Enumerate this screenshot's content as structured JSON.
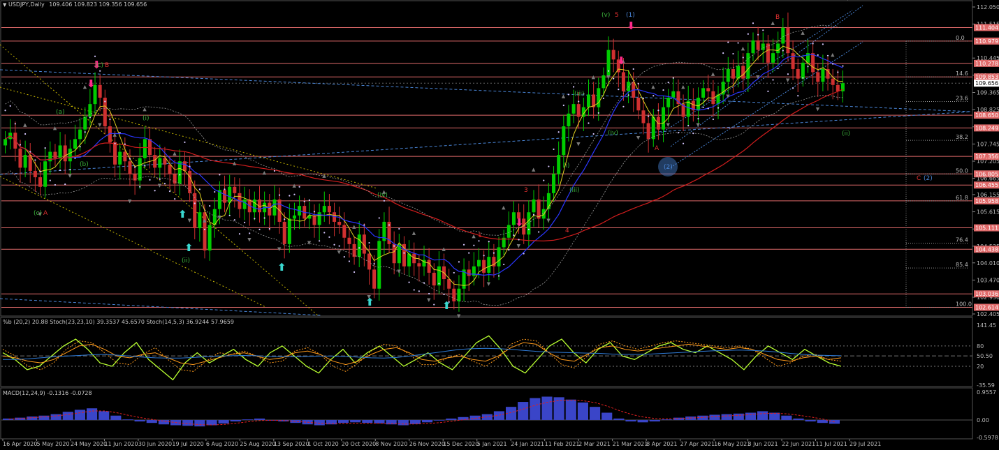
{
  "window": {
    "symbol_label": "USDJPY,Daily",
    "ohlc": "109.406 109.823 109.356 109.656",
    "icon": "triangle-down-icon"
  },
  "indicators": {
    "osc_label": "%b (20,2) 20.88  Stoch(23,23,10) 39.3537 45.6570  Stoch(14,5,3) 36.9244 57.9659",
    "macd_label": "MACD(12,24,9) -0.1316 -0.0728"
  },
  "colors": {
    "background": "#000000",
    "level_line": "#e06a6a",
    "candle_up": "#00cc00",
    "candle_down": "#d03030",
    "ma200": "#d11d1d",
    "ma_blue": "#2a36ff",
    "ma_yellow": "#e0d020",
    "wave_green": "#3ab03a",
    "wave_red": "#e03030",
    "wave_blue": "#4a86d8",
    "arrow_pink": "#ff2a8a",
    "arrow_cyan": "#3ad8d0",
    "sar_dots": "#d7c8ff",
    "fractal": "#7a7a7a"
  },
  "chart_data": [
    {
      "type": "candlestick",
      "title": "USDJPY,Daily",
      "ylim": [
        102.405,
        112.05
      ],
      "y_ticks": [
        "112.050",
        "111.515",
        "110.445",
        "109.905",
        "109.365",
        "108.825",
        "108.285",
        "107.745",
        "107.205",
        "106.665",
        "106.155",
        "105.615",
        "105.075",
        "104.535",
        "104.010",
        "103.470",
        "102.930",
        "102.405"
      ],
      "x_ticks": [
        "16 Apr 2020",
        "5 May 2020",
        "24 May 2020",
        "11 Jun 2020",
        "30 Jun 2020",
        "19 Jul 2020",
        "6 Aug 2020",
        "25 Aug 2020",
        "13 Sep 2020",
        "1 Oct 2020",
        "20 Oct 2020",
        "8 Nov 2020",
        "26 Nov 2020",
        "15 Dec 2020",
        "5 Jan 2021",
        "24 Jan 2021",
        "11 Feb 2021",
        "2 Mar 2021",
        "21 Mar 2021",
        "8 Apr 2021",
        "27 Apr 2021",
        "16 May 2021",
        "3 Jun 2021",
        "22 Jun 2021",
        "11 Jul 2021",
        "29 Jul 2021"
      ],
      "key_levels": [
        111.404,
        110.979,
        110.278,
        109.853,
        108.65,
        108.249,
        107.356,
        106.805,
        106.455,
        105.958,
        105.111,
        104.438,
        103.036,
        102.614
      ],
      "price_label": 109.656,
      "fib_levels": [
        {
          "label": "0.0",
          "value": 110.979
        },
        {
          "label": "14.6",
          "value": 109.853
        },
        {
          "label": "23.6",
          "value": 109.08
        },
        {
          "label": "38.2",
          "value": 107.86
        },
        {
          "label": "50.0",
          "value": 106.805
        },
        {
          "label": "61.8",
          "value": 105.96
        },
        {
          "label": "76.4",
          "value": 104.63
        },
        {
          "label": "85.4",
          "value": 103.85
        },
        {
          "label": "100.0",
          "value": 102.614
        }
      ],
      "closes": [
        107.9,
        108.1,
        107.6,
        107.0,
        107.4,
        106.9,
        106.7,
        106.4,
        107.2,
        107.5,
        107.3,
        107.7,
        107.2,
        107.6,
        107.9,
        108.2,
        108.6,
        109.0,
        109.6,
        109.2,
        108.3,
        107.8,
        107.1,
        107.5,
        107.2,
        106.8,
        106.6,
        107.3,
        107.9,
        107.4,
        107.0,
        107.3,
        107.1,
        106.8,
        106.5,
        107.2,
        106.9,
        106.2,
        105.1,
        105.6,
        104.4,
        105.2,
        105.7,
        106.3,
        105.9,
        106.4,
        106.2,
        105.7,
        106.0,
        105.6,
        106.0,
        105.6,
        105.9,
        105.5,
        106.0,
        105.3,
        104.6,
        105.4,
        105.5,
        105.8,
        105.4,
        105.5,
        105.2,
        105.6,
        105.8,
        105.6,
        105.3,
        105.2,
        104.8,
        104.6,
        104.2,
        104.9,
        104.3,
        103.8,
        103.2,
        104.7,
        105.3,
        104.6,
        104.0,
        104.6,
        103.9,
        104.3,
        104.0,
        103.9,
        104.1,
        103.7,
        103.3,
        103.9,
        103.5,
        103.2,
        102.8,
        103.2,
        103.8,
        103.6,
        103.9,
        104.1,
        103.7,
        104.2,
        103.9,
        104.5,
        104.8,
        105.2,
        105.6,
        105.4,
        104.9,
        105.6,
        106.0,
        105.4,
        105.7,
        106.2,
        106.8,
        107.4,
        108.3,
        108.7,
        109.0,
        108.6,
        108.9,
        109.3,
        108.9,
        109.5,
        109.9,
        110.7,
        110.4,
        110.0,
        109.4,
        109.7,
        109.2,
        108.8,
        108.4,
        107.9,
        108.6,
        108.2,
        108.9,
        109.2,
        109.4,
        109.0,
        108.6,
        109.1,
        108.8,
        109.2,
        109.5,
        109.4,
        109.0,
        109.3,
        109.7,
        110.1,
        109.8,
        110.2,
        109.8,
        110.6,
        111.0,
        110.7,
        110.9,
        110.3,
        110.6,
        110.9,
        111.4,
        110.6,
        110.1,
        109.8,
        110.3,
        110.6,
        110.0,
        109.7,
        110.1,
        109.8,
        109.6,
        109.4,
        109.656
      ]
    },
    {
      "type": "line",
      "title": "%b (20,2) 20.88  Stoch(23,23,10) 39.3537 45.6570  Stoch(14,5,3) 36.9244 57.9659",
      "ylim": [
        -35.59,
        141.45
      ],
      "y_ticks": [
        "141.45",
        "80",
        "50.50",
        "20",
        "-35.59"
      ],
      "series": [
        {
          "name": "%b (20,2)",
          "values": [
            60,
            40,
            10,
            20,
            50,
            80,
            100,
            70,
            30,
            20,
            60,
            90,
            40,
            10,
            -20,
            30,
            60,
            30,
            50,
            70,
            40,
            20,
            60,
            80,
            50,
            20,
            0,
            40,
            70,
            30,
            60,
            80,
            50,
            20,
            40,
            60,
            30,
            10,
            50,
            90,
            110,
            70,
            20,
            0,
            40,
            80,
            100,
            60,
            30,
            70,
            90,
            50,
            40,
            60,
            80,
            90,
            70,
            60,
            80,
            60,
            40,
            10,
            50,
            80,
            60,
            40,
            70,
            50,
            30,
            20
          ]
        },
        {
          "name": "Stoch(23,23,10)",
          "values": [
            50,
            45,
            35,
            30,
            40,
            60,
            80,
            85,
            70,
            50,
            45,
            55,
            60,
            45,
            30,
            25,
            35,
            45,
            55,
            60,
            50,
            40,
            45,
            60,
            65,
            55,
            35,
            25,
            35,
            55,
            70,
            75,
            60,
            40,
            35,
            45,
            50,
            40,
            35,
            50,
            75,
            90,
            85,
            60,
            40,
            35,
            55,
            75,
            80,
            70,
            65,
            70,
            75,
            80,
            85,
            80,
            75,
            70,
            75,
            70,
            55,
            40,
            35,
            45,
            50,
            40,
            45
          ]
        },
        {
          "name": "Stoch(14,5,3)",
          "values": [
            70,
            50,
            20,
            10,
            30,
            70,
            95,
            90,
            60,
            30,
            25,
            55,
            75,
            40,
            10,
            5,
            35,
            60,
            55,
            65,
            50,
            30,
            35,
            65,
            75,
            55,
            20,
            5,
            30,
            65,
            85,
            80,
            55,
            25,
            25,
            45,
            55,
            35,
            20,
            45,
            85,
            100,
            95,
            60,
            25,
            15,
            50,
            85,
            95,
            80,
            70,
            80,
            90,
            95,
            90,
            85,
            80,
            75,
            80,
            70,
            45,
            20,
            30,
            50,
            55,
            40,
            35
          ]
        },
        {
          "name": "oscillator",
          "values": [
            40,
            40,
            42,
            45,
            48,
            50,
            52,
            54,
            55,
            53,
            50,
            47,
            45,
            44,
            44,
            46,
            48,
            50,
            51,
            52,
            51,
            49,
            48,
            48,
            49,
            50,
            50,
            49,
            47,
            45,
            44,
            46,
            50,
            55,
            60,
            65,
            70,
            72,
            73,
            72,
            70,
            67,
            64,
            62,
            61,
            60,
            59,
            58,
            56,
            55,
            55,
            56,
            58,
            60,
            62,
            64,
            66,
            67,
            68,
            67,
            65,
            62,
            58,
            55,
            53,
            52,
            51
          ]
        }
      ]
    },
    {
      "type": "bar",
      "title": "MACD(12,24,9) -0.1316 -0.0728",
      "ylim": [
        -0.5978,
        0.9557
      ],
      "y_ticks": [
        "0.9557",
        "0.00",
        "-0.5978"
      ],
      "series": [
        {
          "name": "MACD(12,24,9)",
          "values": [
            0.05,
            0.08,
            0.12,
            0.15,
            0.2,
            0.28,
            0.35,
            0.4,
            0.3,
            0.15,
            0.02,
            -0.05,
            -0.1,
            -0.15,
            -0.18,
            -0.2,
            -0.22,
            -0.18,
            -0.12,
            -0.05,
            0.02,
            0.05,
            0.0,
            -0.05,
            -0.1,
            -0.15,
            -0.18,
            -0.15,
            -0.1,
            -0.08,
            -0.1,
            -0.12,
            -0.15,
            -0.18,
            -0.14,
            -0.08,
            -0.02,
            0.05,
            0.1,
            0.15,
            0.2,
            0.3,
            0.45,
            0.62,
            0.75,
            0.8,
            0.78,
            0.7,
            0.6,
            0.45,
            0.25,
            0.05,
            -0.05,
            -0.08,
            -0.05,
            0.02,
            0.08,
            0.12,
            0.15,
            0.18,
            0.2,
            0.22,
            0.25,
            0.3,
            0.25,
            0.15,
            0.05,
            -0.05,
            -0.1,
            -0.13
          ]
        },
        {
          "name": "signal",
          "values": [
            0.03,
            0.05,
            0.08,
            0.11,
            0.14,
            0.19,
            0.25,
            0.31,
            0.31,
            0.25,
            0.16,
            0.08,
            0.02,
            -0.04,
            -0.09,
            -0.13,
            -0.16,
            -0.17,
            -0.15,
            -0.11,
            -0.06,
            -0.02,
            -0.01,
            -0.02,
            -0.05,
            -0.08,
            -0.11,
            -0.12,
            -0.12,
            -0.11,
            -0.11,
            -0.11,
            -0.12,
            -0.14,
            -0.14,
            -0.12,
            -0.09,
            -0.04,
            0.01,
            0.06,
            0.11,
            0.17,
            0.26,
            0.38,
            0.51,
            0.61,
            0.67,
            0.68,
            0.66,
            0.59,
            0.47,
            0.32,
            0.19,
            0.1,
            0.05,
            0.04,
            0.05,
            0.07,
            0.09,
            0.12,
            0.14,
            0.16,
            0.19,
            0.22,
            0.23,
            0.21,
            0.16,
            0.1,
            0.03,
            -0.07
          ]
        }
      ]
    }
  ],
  "annotations": {
    "wave_labels": [
      {
        "text": "(c)",
        "color": "green"
      },
      {
        "text": "B",
        "color": "red"
      },
      {
        "text": "(a)",
        "color": "green"
      },
      {
        "text": "(i)",
        "color": "green"
      },
      {
        "text": "(b)",
        "color": "green"
      },
      {
        "text": "(ii)",
        "color": "green"
      },
      {
        "text": "(c)",
        "color": "green"
      },
      {
        "text": "A",
        "color": "red"
      },
      {
        "text": "(iii)",
        "color": "green"
      },
      {
        "text": "(iv)",
        "color": "green"
      },
      {
        "text": "1",
        "color": "red"
      },
      {
        "text": "3",
        "color": "red"
      },
      {
        "text": "4",
        "color": "red"
      },
      {
        "text": "(i)",
        "color": "green"
      },
      {
        "text": "(iii)",
        "color": "green"
      },
      {
        "text": "(v)",
        "color": "green"
      },
      {
        "text": "5",
        "color": "red"
      },
      {
        "text": "(1)",
        "color": "blue"
      },
      {
        "text": "A",
        "color": "red"
      },
      {
        "text": "(2)",
        "color": "blue"
      },
      {
        "text": "B",
        "color": "red"
      },
      {
        "text": "C",
        "color": "red"
      },
      {
        "text": "(2)",
        "color": "blue"
      },
      {
        "text": "(iv)",
        "color": "green"
      },
      {
        "text": "(ii)",
        "color": "green"
      }
    ]
  }
}
